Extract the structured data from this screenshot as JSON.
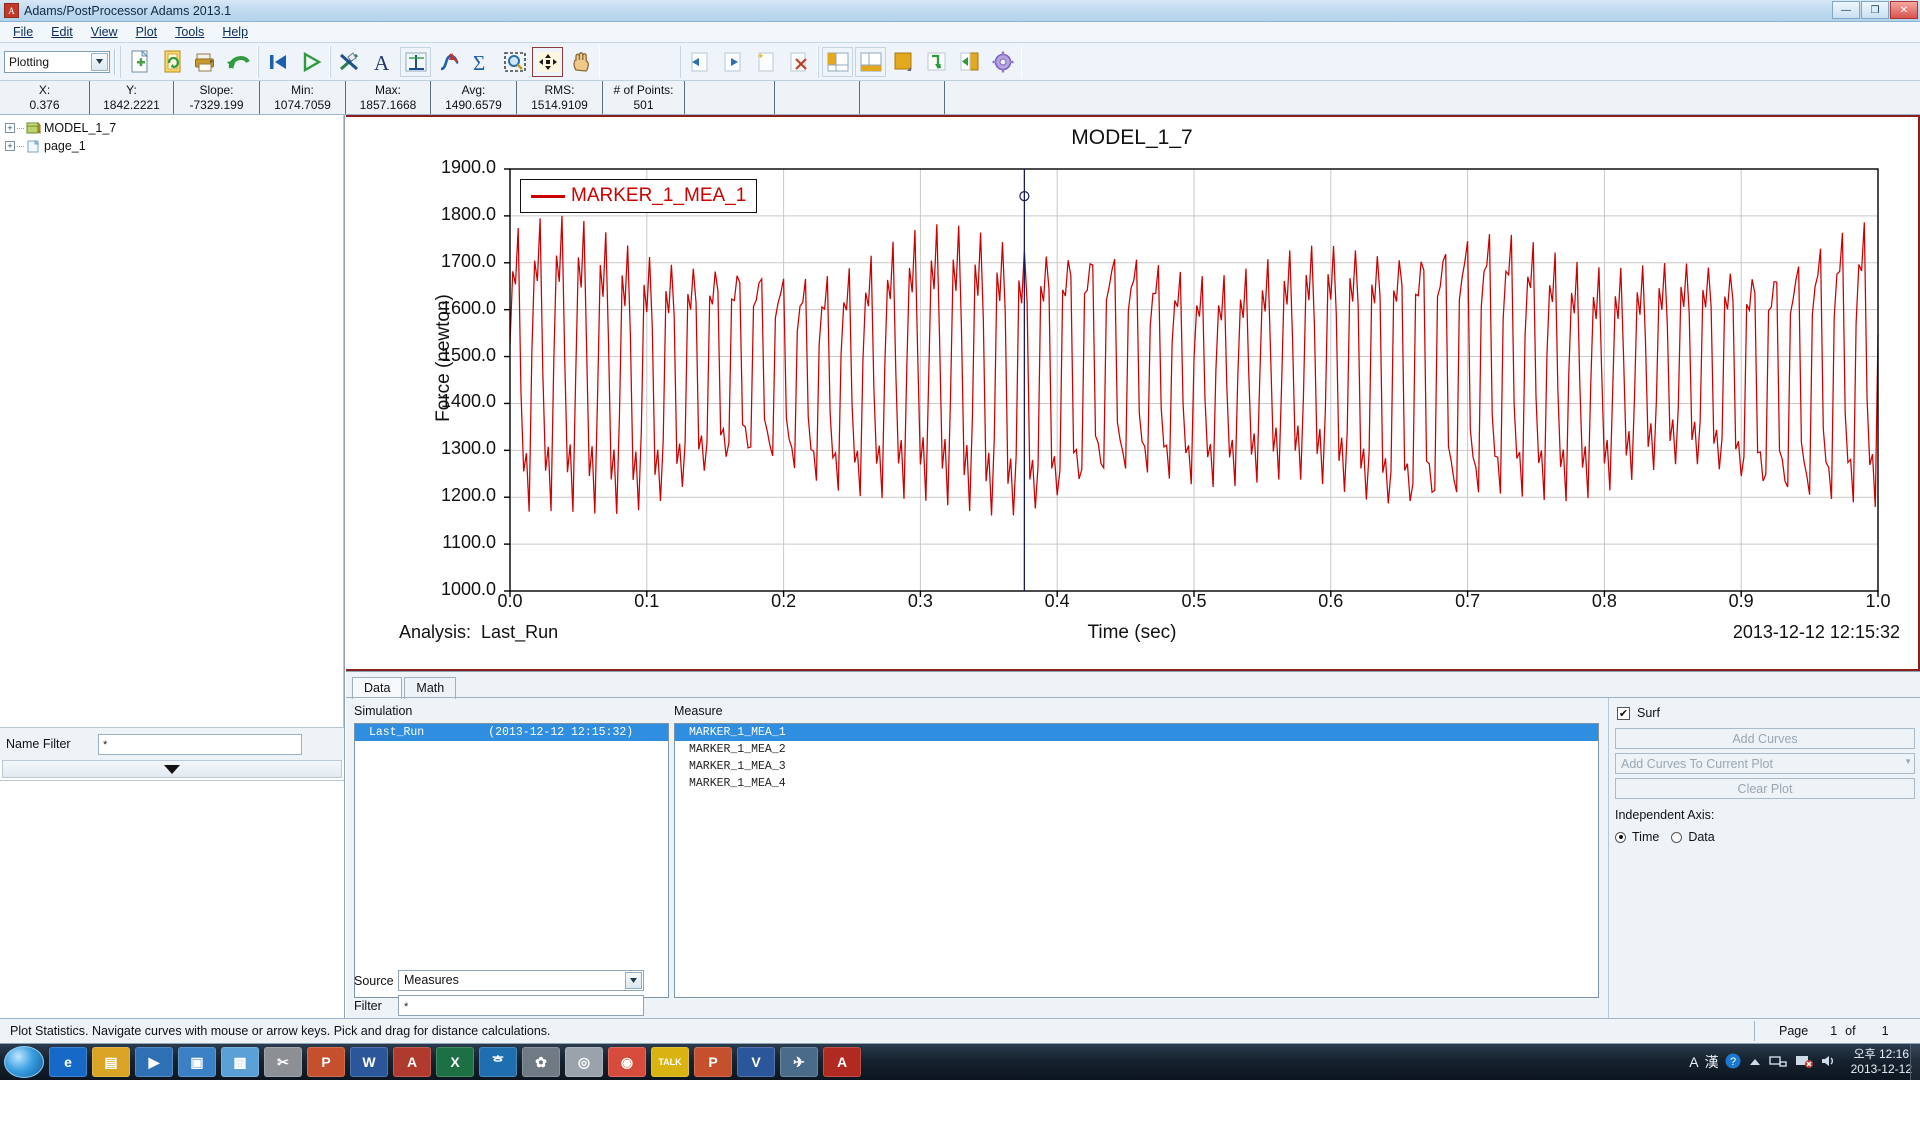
{
  "window": {
    "title": "Adams/PostProcessor Adams 2013.1",
    "app_icon": "adams-icon",
    "minimize": "—",
    "maximize": "❐",
    "close": "✕"
  },
  "menu": {
    "items": [
      "File",
      "Edit",
      "View",
      "Plot",
      "Tools",
      "Help"
    ]
  },
  "toolbar": {
    "mode_value": "Plotting",
    "mode_options": [
      "Plotting"
    ],
    "buttons": [
      "new-page-icon",
      "reload-icon",
      "print-icon",
      "undo-icon",
      "first-frame-icon",
      "play-icon",
      "clear-icon",
      "text-icon",
      "axis-icon",
      "curve-icon",
      "sum-icon",
      "zoom-select-icon",
      "fit-view-icon",
      "pan-hand-icon",
      "page-prev-icon",
      "page-next-icon",
      "page-new-icon",
      "page-delete-icon",
      "layout-left-icon",
      "layout-bottom-icon",
      "layout-single-icon",
      "swap-icon",
      "back-icon",
      "settings-gear-icon"
    ]
  },
  "statistics": {
    "cells": [
      {
        "label": "X:",
        "value": "0.376"
      },
      {
        "label": "Y:",
        "value": "1842.2221"
      },
      {
        "label": "Slope:",
        "value": "-7329.199"
      },
      {
        "label": "Min:",
        "value": "1074.7059"
      },
      {
        "label": "Max:",
        "value": "1857.1668"
      },
      {
        "label": "Avg:",
        "value": "1490.6579"
      },
      {
        "label": "RMS:",
        "value": "1514.9109"
      },
      {
        "label": "# of Points:",
        "value": "501"
      }
    ]
  },
  "tree": {
    "items": [
      {
        "label": "MODEL_1_7",
        "icon": "model-folder-icon",
        "expander": "+"
      },
      {
        "label": "page_1",
        "icon": "page-icon",
        "expander": "+"
      }
    ]
  },
  "name_filter": {
    "label": "Name Filter",
    "value": "*",
    "placeholder": "*",
    "dropdown_icon": "chevron-down-icon"
  },
  "chart_data": {
    "type": "line",
    "title": "MODEL_1_7",
    "xlabel": "Time (sec)",
    "ylabel": "Force (newton)",
    "xlim": [
      0.0,
      1.0
    ],
    "ylim": [
      1000.0,
      1900.0
    ],
    "xticks": [
      "0.0",
      "0.1",
      "0.2",
      "0.3",
      "0.4",
      "0.5",
      "0.6",
      "0.7",
      "0.8",
      "0.9",
      "1.0"
    ],
    "yticks": [
      "1900.0",
      "1800.0",
      "1700.0",
      "1600.0",
      "1500.0",
      "1400.0",
      "1300.0",
      "1200.0",
      "1100.0",
      "1000.0"
    ],
    "grid": true,
    "legend": {
      "position": "top-left",
      "entries": [
        {
          "name": "MARKER_1_MEA_1",
          "color": "#cc0000"
        }
      ]
    },
    "series": [
      {
        "name": "MARKER_1_MEA_1",
        "color": "#cc0000",
        "n_points": 501,
        "min": 1074.7059,
        "max": 1857.1668,
        "avg": 1490.6579,
        "rms": 1514.9109,
        "description": "High-frequency oscillating force, ~62 cycles over 0-1 s, envelope roughly 1075 to 1860 newton, mean near 1490 newton"
      }
    ],
    "cursor": {
      "x": 0.376,
      "y": 1842.2221,
      "slope": -7329.199
    },
    "annotations": {
      "analysis_label": "Analysis:",
      "analysis_value": "Last_Run",
      "timestamp": "2013-12-12 12:15:32"
    }
  },
  "dock": {
    "tabs": [
      {
        "label": "Data",
        "active": true
      },
      {
        "label": "Math",
        "active": false
      }
    ],
    "simulation": {
      "label": "Simulation",
      "rows": [
        {
          "name": "Last_Run",
          "time": "(2013-12-12 12:15:32)",
          "selected": true
        }
      ]
    },
    "measure": {
      "label": "Measure",
      "rows": [
        {
          "name": "MARKER_1_MEA_1",
          "selected": true
        },
        {
          "name": "MARKER_1_MEA_2",
          "selected": false
        },
        {
          "name": "MARKER_1_MEA_3",
          "selected": false
        },
        {
          "name": "MARKER_1_MEA_4",
          "selected": false
        }
      ]
    },
    "source": {
      "label": "Source",
      "value": "Measures",
      "options": [
        "Measures"
      ]
    },
    "filter": {
      "label": "Filter",
      "value": "*",
      "placeholder": "*"
    },
    "right": {
      "surf_label": "Surf",
      "surf_checked": "✔",
      "add_curves_label": "Add Curves",
      "add_curves_to_plot_label": "Add Curves To Current Plot",
      "clear_plot_label": "Clear Plot",
      "independent_axis_label": "Independent Axis:",
      "radio_time_label": "Time",
      "radio_data_label": "Data",
      "radio_selected": "Time"
    }
  },
  "statusbar": {
    "message": "Plot Statistics.  Navigate curves with mouse or arrow keys.  Pick and drag for distance calculations.",
    "page_label": "Page",
    "page_current": "1",
    "page_of": "of",
    "page_total": "1"
  },
  "taskbar": {
    "start": "start-orb-icon",
    "items": [
      {
        "name": "internet-explorer-icon",
        "glyph": "e",
        "color": "#1769c7"
      },
      {
        "name": "file-explorer-icon",
        "glyph": "▤",
        "color": "#d9a326"
      },
      {
        "name": "media-player-icon",
        "glyph": "▶",
        "color": "#2f6fb4"
      },
      {
        "name": "window-icon",
        "glyph": "▣",
        "color": "#3b7fc4"
      },
      {
        "name": "image-viewer-icon",
        "glyph": "▩",
        "color": "#5aa0d6"
      },
      {
        "name": "snipping-tool-icon",
        "glyph": "✂",
        "color": "#8c8f94"
      },
      {
        "name": "powerpoint-icon",
        "glyph": "P",
        "color": "#c5502e"
      },
      {
        "name": "word-icon",
        "glyph": "W",
        "color": "#2b579a"
      },
      {
        "name": "autocad-icon",
        "glyph": "A",
        "color": "#b03a2e"
      },
      {
        "name": "excel-icon",
        "glyph": "X",
        "color": "#1d7044"
      },
      {
        "name": "hancom-icon",
        "glyph": "ᄒ",
        "color": "#1f6fb0"
      },
      {
        "name": "settings-icon",
        "glyph": "✿",
        "color": "#6f7a85"
      },
      {
        "name": "cd-burner-icon",
        "glyph": "◎",
        "color": "#9aa3ab"
      },
      {
        "name": "chrome-icon",
        "glyph": "◉",
        "color": "#d64b3c"
      },
      {
        "name": "kakaotalk-icon",
        "glyph": "TALK",
        "color": "#d9b310"
      },
      {
        "name": "powerpoint2-icon",
        "glyph": "P",
        "color": "#c5502e"
      },
      {
        "name": "visio-icon",
        "glyph": "V",
        "color": "#2b579a"
      },
      {
        "name": "adams-postprocessor-icon",
        "glyph": "✈",
        "color": "#4a6b8a"
      },
      {
        "name": "adams-active-icon",
        "glyph": "A",
        "color": "#b02a22"
      }
    ],
    "tray": {
      "ime_a": "A",
      "ime_han": "漢",
      "help_icon": "help-icon",
      "overflow_icon": "chevron-up-icon",
      "network_icon": "network-icon",
      "action_icon": "action-center-icon",
      "volume_icon": "volume-icon",
      "time": "오후 12:16",
      "date": "2013-12-12"
    }
  }
}
